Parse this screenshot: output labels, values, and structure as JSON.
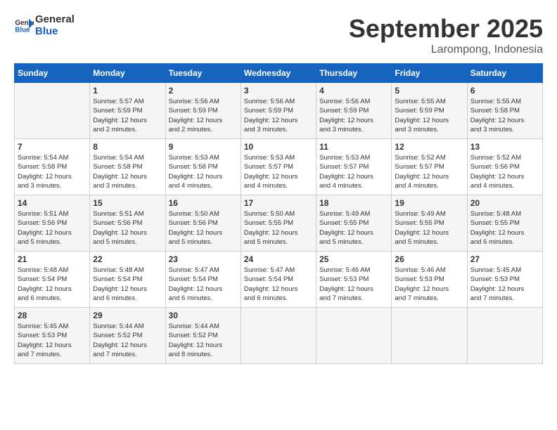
{
  "header": {
    "logo_line1": "General",
    "logo_line2": "Blue",
    "month_year": "September 2025",
    "location": "Larompong, Indonesia"
  },
  "days_of_week": [
    "Sunday",
    "Monday",
    "Tuesday",
    "Wednesday",
    "Thursday",
    "Friday",
    "Saturday"
  ],
  "weeks": [
    [
      {
        "day": "",
        "info": ""
      },
      {
        "day": "1",
        "info": "Sunrise: 5:57 AM\nSunset: 5:59 PM\nDaylight: 12 hours\nand 2 minutes."
      },
      {
        "day": "2",
        "info": "Sunrise: 5:56 AM\nSunset: 5:59 PM\nDaylight: 12 hours\nand 2 minutes."
      },
      {
        "day": "3",
        "info": "Sunrise: 5:56 AM\nSunset: 5:59 PM\nDaylight: 12 hours\nand 3 minutes."
      },
      {
        "day": "4",
        "info": "Sunrise: 5:56 AM\nSunset: 5:59 PM\nDaylight: 12 hours\nand 3 minutes."
      },
      {
        "day": "5",
        "info": "Sunrise: 5:55 AM\nSunset: 5:59 PM\nDaylight: 12 hours\nand 3 minutes."
      },
      {
        "day": "6",
        "info": "Sunrise: 5:55 AM\nSunset: 5:58 PM\nDaylight: 12 hours\nand 3 minutes."
      }
    ],
    [
      {
        "day": "7",
        "info": "Sunrise: 5:54 AM\nSunset: 5:58 PM\nDaylight: 12 hours\nand 3 minutes."
      },
      {
        "day": "8",
        "info": "Sunrise: 5:54 AM\nSunset: 5:58 PM\nDaylight: 12 hours\nand 3 minutes."
      },
      {
        "day": "9",
        "info": "Sunrise: 5:53 AM\nSunset: 5:58 PM\nDaylight: 12 hours\nand 4 minutes."
      },
      {
        "day": "10",
        "info": "Sunrise: 5:53 AM\nSunset: 5:57 PM\nDaylight: 12 hours\nand 4 minutes."
      },
      {
        "day": "11",
        "info": "Sunrise: 5:53 AM\nSunset: 5:57 PM\nDaylight: 12 hours\nand 4 minutes."
      },
      {
        "day": "12",
        "info": "Sunrise: 5:52 AM\nSunset: 5:57 PM\nDaylight: 12 hours\nand 4 minutes."
      },
      {
        "day": "13",
        "info": "Sunrise: 5:52 AM\nSunset: 5:56 PM\nDaylight: 12 hours\nand 4 minutes."
      }
    ],
    [
      {
        "day": "14",
        "info": "Sunrise: 5:51 AM\nSunset: 5:56 PM\nDaylight: 12 hours\nand 5 minutes."
      },
      {
        "day": "15",
        "info": "Sunrise: 5:51 AM\nSunset: 5:56 PM\nDaylight: 12 hours\nand 5 minutes."
      },
      {
        "day": "16",
        "info": "Sunrise: 5:50 AM\nSunset: 5:56 PM\nDaylight: 12 hours\nand 5 minutes."
      },
      {
        "day": "17",
        "info": "Sunrise: 5:50 AM\nSunset: 5:55 PM\nDaylight: 12 hours\nand 5 minutes."
      },
      {
        "day": "18",
        "info": "Sunrise: 5:49 AM\nSunset: 5:55 PM\nDaylight: 12 hours\nand 5 minutes."
      },
      {
        "day": "19",
        "info": "Sunrise: 5:49 AM\nSunset: 5:55 PM\nDaylight: 12 hours\nand 5 minutes."
      },
      {
        "day": "20",
        "info": "Sunrise: 5:48 AM\nSunset: 5:55 PM\nDaylight: 12 hours\nand 6 minutes."
      }
    ],
    [
      {
        "day": "21",
        "info": "Sunrise: 5:48 AM\nSunset: 5:54 PM\nDaylight: 12 hours\nand 6 minutes."
      },
      {
        "day": "22",
        "info": "Sunrise: 5:48 AM\nSunset: 5:54 PM\nDaylight: 12 hours\nand 6 minutes."
      },
      {
        "day": "23",
        "info": "Sunrise: 5:47 AM\nSunset: 5:54 PM\nDaylight: 12 hours\nand 6 minutes."
      },
      {
        "day": "24",
        "info": "Sunrise: 5:47 AM\nSunset: 5:54 PM\nDaylight: 12 hours\nand 6 minutes."
      },
      {
        "day": "25",
        "info": "Sunrise: 5:46 AM\nSunset: 5:53 PM\nDaylight: 12 hours\nand 7 minutes."
      },
      {
        "day": "26",
        "info": "Sunrise: 5:46 AM\nSunset: 5:53 PM\nDaylight: 12 hours\nand 7 minutes."
      },
      {
        "day": "27",
        "info": "Sunrise: 5:45 AM\nSunset: 5:53 PM\nDaylight: 12 hours\nand 7 minutes."
      }
    ],
    [
      {
        "day": "28",
        "info": "Sunrise: 5:45 AM\nSunset: 5:53 PM\nDaylight: 12 hours\nand 7 minutes."
      },
      {
        "day": "29",
        "info": "Sunrise: 5:44 AM\nSunset: 5:52 PM\nDaylight: 12 hours\nand 7 minutes."
      },
      {
        "day": "30",
        "info": "Sunrise: 5:44 AM\nSunset: 5:52 PM\nDaylight: 12 hours\nand 8 minutes."
      },
      {
        "day": "",
        "info": ""
      },
      {
        "day": "",
        "info": ""
      },
      {
        "day": "",
        "info": ""
      },
      {
        "day": "",
        "info": ""
      }
    ]
  ]
}
